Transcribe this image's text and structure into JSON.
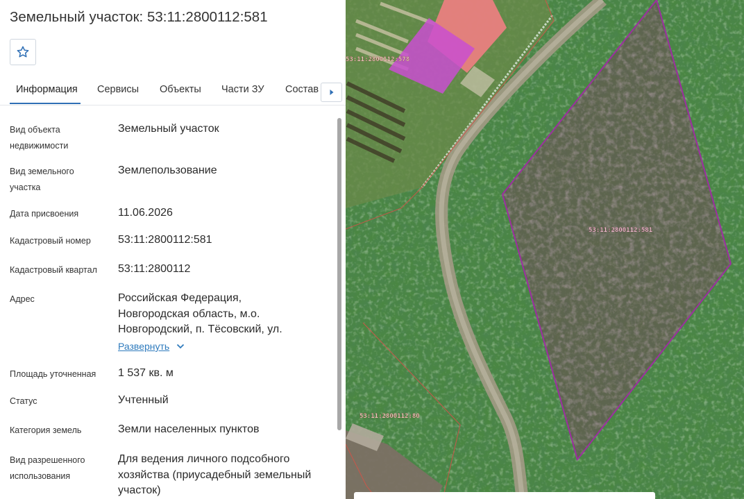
{
  "header": {
    "title": "Земельный участок: 53:11:2800112:581"
  },
  "tabs": [
    "Информация",
    "Сервисы",
    "Объекты",
    "Части ЗУ",
    "Состав"
  ],
  "fields": [
    {
      "label": "Вид объекта недвижимости",
      "value": "Земельный участок"
    },
    {
      "label": "Вид земельного участка",
      "value": "Землепользование"
    },
    {
      "label": "Дата присвоения",
      "value": "11.06.2026"
    },
    {
      "label": "Кадастровый номер",
      "value": "53:11:2800112:581"
    },
    {
      "label": "Кадастровый квартал",
      "value": "53:11:2800112"
    },
    {
      "label": "Адрес",
      "value": "Российская Федерация, Новгородская область, м.о. Новгородский, п. Тёсовский, ул."
    },
    {
      "label": "Площадь уточненная",
      "value": "1 537 кв. м"
    },
    {
      "label": "Статус",
      "value": "Учтенный"
    },
    {
      "label": "Категория земель",
      "value": "Земли населенных пунктов"
    },
    {
      "label": "Вид разрешенного использования",
      "value": "Для ведения личного подсобного хозяйства (приусадебный земельный участок)"
    }
  ],
  "address_expand_label": "Развернуть",
  "map": {
    "parcel_labels": [
      "53:11:2800112:581",
      "53:11:2800112:80",
      "53:11:2800112:578"
    ]
  },
  "colors": {
    "accent": "#2f6fb5",
    "link": "#2f7bbd",
    "parcel_outline": "#9c2ea0",
    "highlight": "#c94fd0"
  },
  "icons": {
    "favorite": "star-outline-icon",
    "tabs_next": "triangle-right-icon",
    "expand": "chevron-down-icon"
  }
}
